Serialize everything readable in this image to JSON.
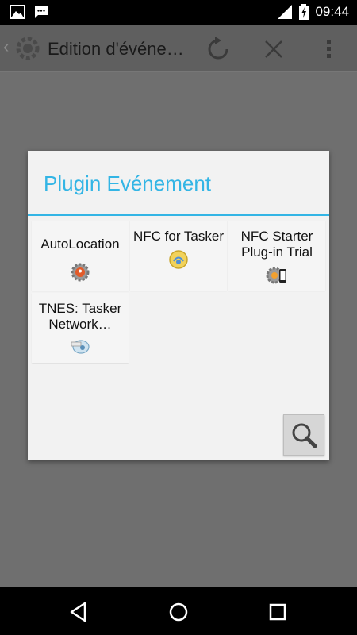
{
  "status_bar": {
    "time": "09:44",
    "left_icons": [
      "image-icon",
      "chat-icon"
    ],
    "right_icons": [
      "signal-icon",
      "battery-charging-icon"
    ]
  },
  "action_bar": {
    "title": "Edition d'événe…",
    "buttons": [
      "refresh-icon",
      "close-icon",
      "overflow-menu-icon"
    ]
  },
  "dialog": {
    "title": "Plugin Evénement",
    "accent_color": "#33b5e5",
    "plugins": [
      {
        "label": "AutoLocation",
        "icon": "autolocation-gear-icon"
      },
      {
        "label": "NFC for Tasker",
        "icon": "nfc-for-tasker-icon"
      },
      {
        "label": "NFC Starter Plug-in Trial",
        "icon": "nfc-starter-gear-phone-icon"
      },
      {
        "label": "TNES: Tasker Network…",
        "icon": "tnes-plugin-icon"
      }
    ],
    "search_button": "search-icon"
  },
  "nav_bar": {
    "buttons": [
      "back-icon",
      "home-icon",
      "recents-icon"
    ]
  }
}
